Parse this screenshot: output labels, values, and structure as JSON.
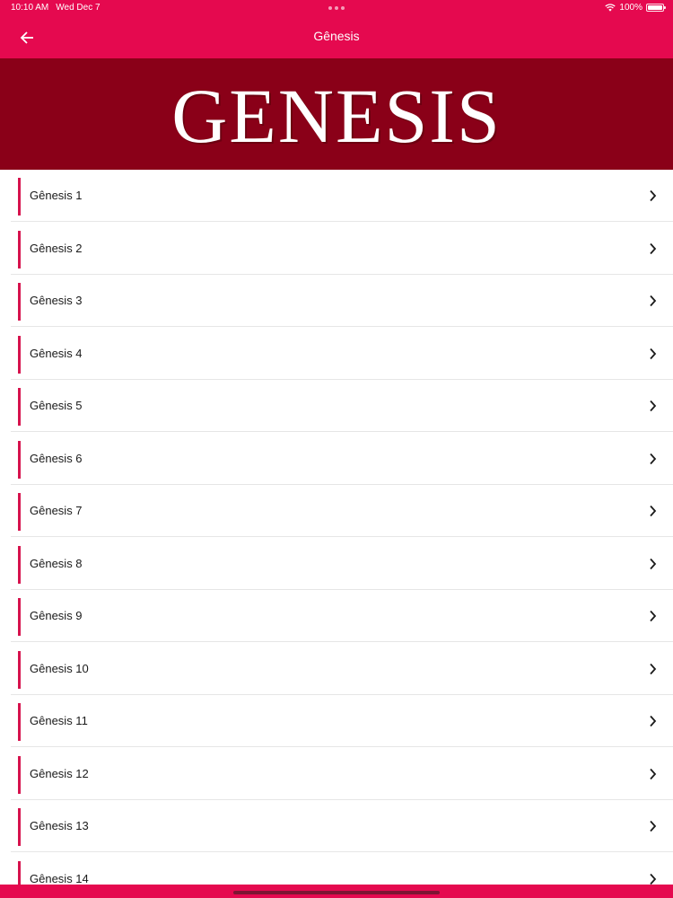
{
  "status_bar": {
    "time": "10:10 AM",
    "date": "Wed Dec 7",
    "battery": "100%"
  },
  "header": {
    "title": "Gênesis",
    "back_icon": "arrow-left-icon"
  },
  "banner": {
    "text": "GENESIS"
  },
  "chapters": [
    {
      "label": "Gênesis 1"
    },
    {
      "label": "Gênesis 2"
    },
    {
      "label": "Gênesis 3"
    },
    {
      "label": "Gênesis 4"
    },
    {
      "label": "Gênesis 5"
    },
    {
      "label": "Gênesis 6"
    },
    {
      "label": "Gênesis 7"
    },
    {
      "label": "Gênesis 8"
    },
    {
      "label": "Gênesis 9"
    },
    {
      "label": "Gênesis 10"
    },
    {
      "label": "Gênesis 11"
    },
    {
      "label": "Gênesis 12"
    },
    {
      "label": "Gênesis 13"
    },
    {
      "label": "Gênesis 14"
    }
  ],
  "colors": {
    "header": "#e5094f",
    "banner": "#8a0018",
    "accent": "#d6124d"
  }
}
